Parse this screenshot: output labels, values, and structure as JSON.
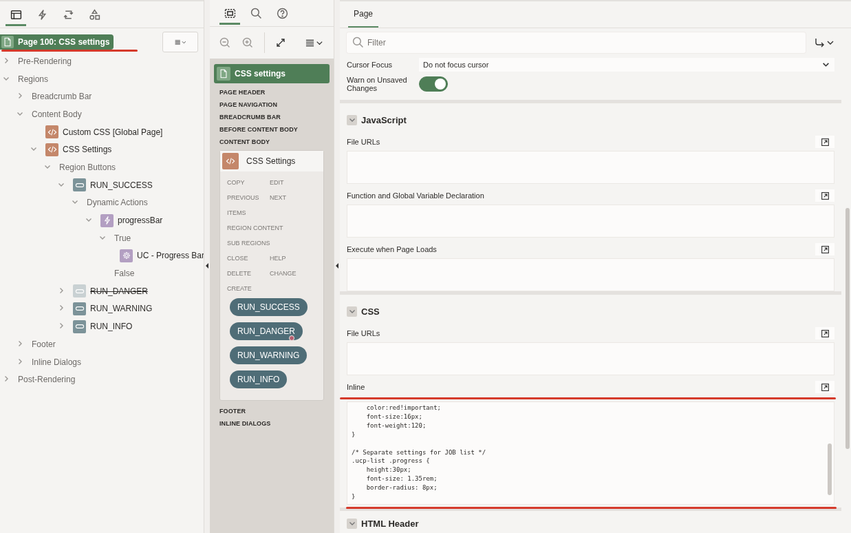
{
  "left_tabs": [
    {
      "kind": "rendering",
      "selected": true
    },
    {
      "kind": "dynamic-actions",
      "selected": false
    },
    {
      "kind": "processing",
      "selected": false
    },
    {
      "kind": "shared-components",
      "selected": false
    }
  ],
  "page_node": {
    "label": "Page 100: CSS settings",
    "selected": true
  },
  "tree": [
    {
      "label": "Pre-Rendering",
      "kind": "group",
      "expanded": false,
      "disabled": false
    },
    {
      "label": "Regions",
      "kind": "group",
      "expanded": true,
      "disabled": false,
      "children": [
        {
          "label": "Breadcrumb Bar",
          "kind": "group",
          "expanded": false,
          "disabled": false
        },
        {
          "label": "Content Body",
          "kind": "group",
          "expanded": true,
          "disabled": false,
          "children": [
            {
              "label": "Custom CSS [Global Page]",
              "kind": "region",
              "disabled": false
            },
            {
              "label": "CSS Settings",
              "kind": "region",
              "expanded": true,
              "disabled": false,
              "children": [
                {
                  "label": "Region Buttons",
                  "kind": "group",
                  "expanded": true,
                  "disabled": false,
                  "children": [
                    {
                      "label": "RUN_SUCCESS",
                      "kind": "button",
                      "expanded": true,
                      "disabled": false,
                      "children": [
                        {
                          "label": "Dynamic Actions",
                          "kind": "group",
                          "expanded": true,
                          "disabled": false,
                          "children": [
                            {
                              "label": "progressBar",
                              "kind": "dynamic-action",
                              "expanded": true,
                              "disabled": false,
                              "children": [
                                {
                                  "label": "True",
                                  "kind": "group",
                                  "expanded": true,
                                  "disabled": false,
                                  "children": [
                                    {
                                      "label": "UC - Progress Bar",
                                      "kind": "action",
                                      "disabled": false
                                    }
                                  ]
                                },
                                {
                                  "label": "False",
                                  "kind": "group",
                                  "disabled": false
                                }
                              ]
                            }
                          ]
                        }
                      ]
                    },
                    {
                      "label": "RUN_DANGER",
                      "kind": "button",
                      "expanded": false,
                      "disabled": true
                    },
                    {
                      "label": "RUN_WARNING",
                      "kind": "button",
                      "expanded": false,
                      "disabled": false
                    },
                    {
                      "label": "RUN_INFO",
                      "kind": "button",
                      "expanded": false,
                      "disabled": false
                    }
                  ]
                }
              ]
            }
          ]
        },
        {
          "label": "Footer",
          "kind": "group",
          "expanded": false,
          "disabled": false
        },
        {
          "label": "Inline Dialogs",
          "kind": "group",
          "expanded": false,
          "disabled": false
        }
      ]
    },
    {
      "label": "Post-Rendering",
      "kind": "group",
      "expanded": false,
      "disabled": false
    }
  ],
  "middle_tabs": [
    {
      "kind": "layout",
      "selected": true
    },
    {
      "kind": "search",
      "selected": false
    },
    {
      "kind": "help",
      "selected": false
    }
  ],
  "layout": {
    "page_title": "CSS settings",
    "positions_before": [
      "PAGE HEADER",
      "PAGE NAVIGATION",
      "BREADCRUMB BAR",
      "BEFORE CONTENT BODY",
      "CONTENT BODY"
    ],
    "region": {
      "title": "CSS Settings",
      "slots": [
        [
          "COPY",
          "EDIT"
        ],
        [
          "PREVIOUS",
          "NEXT"
        ],
        [
          "ITEMS"
        ],
        [
          "REGION CONTENT"
        ],
        [
          "SUB REGIONS"
        ],
        [
          "CLOSE",
          "HELP"
        ],
        [
          "DELETE",
          "CHANGE"
        ],
        [
          "CREATE"
        ]
      ],
      "buttons": [
        {
          "label": "RUN_SUCCESS",
          "flagged": false
        },
        {
          "label": "RUN_DANGER",
          "flagged": true
        },
        {
          "label": "RUN_WARNING",
          "flagged": false
        },
        {
          "label": "RUN_INFO",
          "flagged": false
        }
      ]
    },
    "positions_after": [
      "FOOTER",
      "INLINE DIALOGS"
    ]
  },
  "properties": {
    "tabs": [
      {
        "label": "Page",
        "selected": true
      }
    ],
    "filter": {
      "placeholder": "Filter"
    },
    "fields": [
      {
        "kind": "select",
        "label": "Cursor Focus",
        "value": "Do not focus cursor"
      },
      {
        "kind": "switch",
        "label": "Warn on Unsaved Changes",
        "on": true
      }
    ],
    "sections": [
      {
        "title": "JavaScript",
        "expanded": true,
        "fields": [
          {
            "label": "File URLs",
            "kind": "text"
          },
          {
            "label": "Function and Global Variable Declaration",
            "kind": "text"
          },
          {
            "label": "Execute when Page Loads",
            "kind": "text"
          }
        ]
      },
      {
        "title": "CSS",
        "expanded": true,
        "fields": [
          {
            "label": "File URLs",
            "kind": "text"
          },
          {
            "label": "Inline",
            "kind": "code",
            "value": "    color:red!important;\n    font-size:16px;\n    font-weight:120;\n}\n\n/* Separate settings for JOB list */\n.ucp-list .progress {\n    height:30px;\n    font-size: 1.35rem;\n    border-radius: 8px;\n}"
          }
        ]
      },
      {
        "title": "HTML Header",
        "expanded": true
      }
    ]
  }
}
